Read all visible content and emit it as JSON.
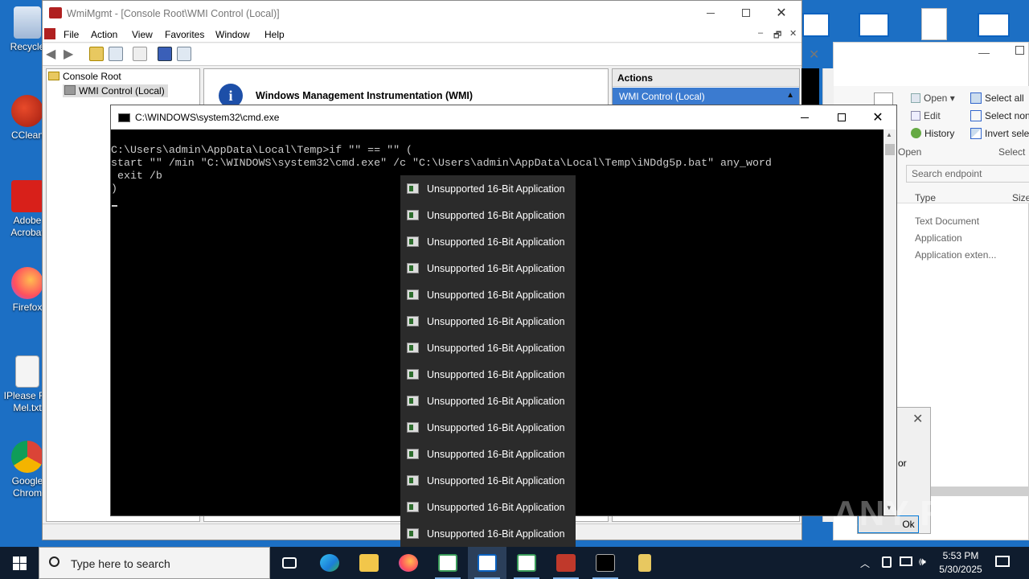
{
  "desktop": {
    "icons": [
      {
        "name": "recycle-bin",
        "label": "Recycle"
      },
      {
        "name": "ccleaner",
        "label": "CClean"
      },
      {
        "name": "adobe-acrobat",
        "label": "Adobe Acrobat"
      },
      {
        "name": "firefox",
        "label": "Firefox"
      },
      {
        "name": "text-file",
        "label": "IPlease Re Mel.txt"
      },
      {
        "name": "google-chrome",
        "label": "Google Chrom"
      }
    ]
  },
  "mmc": {
    "title": "WmiMgmt - [Console Root\\WMI Control (Local)]",
    "menu": [
      "File",
      "Action",
      "View",
      "Favorites",
      "Window",
      "Help"
    ],
    "tree": {
      "root": "Console Root",
      "child": "WMI Control (Local)"
    },
    "main_heading": "Windows Management Instrumentation (WMI)",
    "actions": {
      "header": "Actions",
      "item": "WMI Control (Local)"
    }
  },
  "explorer": {
    "open_group": {
      "open": "Open",
      "edit": "Edit",
      "history": "History",
      "label": "Open"
    },
    "select_group": {
      "select_all": "Select all",
      "select_none": "Select non",
      "invert": "Invert selec",
      "label": "Select"
    },
    "search_placeholder": "Search endpoint",
    "columns": {
      "type": "Type",
      "size": "Size"
    },
    "rows": [
      "Text Document",
      "Application",
      "Application exten..."
    ]
  },
  "dialog": {
    "text": "or",
    "ok": "Ok"
  },
  "cmd": {
    "title": "C:\\WINDOWS\\system32\\cmd.exe",
    "lines": [
      "C:\\Users\\admin\\AppData\\Local\\Temp>if \"\" == \"\" (",
      "start \"\" /min \"C:\\WINDOWS\\system32\\cmd.exe\" /c \"C:\\Users\\admin\\AppData\\Local\\Temp\\iNDdg5p.bat\" any_word",
      " exit /b",
      ")"
    ]
  },
  "popup": {
    "items": [
      "Unsupported 16-Bit Application",
      "Unsupported 16-Bit Application",
      "Unsupported 16-Bit Application",
      "Unsupported 16-Bit Application",
      "Unsupported 16-Bit Application",
      "Unsupported 16-Bit Application",
      "Unsupported 16-Bit Application",
      "Unsupported 16-Bit Application",
      "Unsupported 16-Bit Application",
      "Unsupported 16-Bit Application",
      "Unsupported 16-Bit Application",
      "Unsupported 16-Bit Application",
      "Unsupported 16-Bit Application",
      "Unsupported 16-Bit Application"
    ]
  },
  "taskbar": {
    "search_placeholder": "Type here to search",
    "time": "5:53 PM",
    "date": "5/30/2025"
  },
  "watermark": "ANY RUN",
  "colors": {
    "desktop": "#1c6fc4",
    "taskbar": "#0f1c2e",
    "cmd_bg": "#000000",
    "popup_bg": "#2b2b2b",
    "accent": "#0078d7"
  }
}
